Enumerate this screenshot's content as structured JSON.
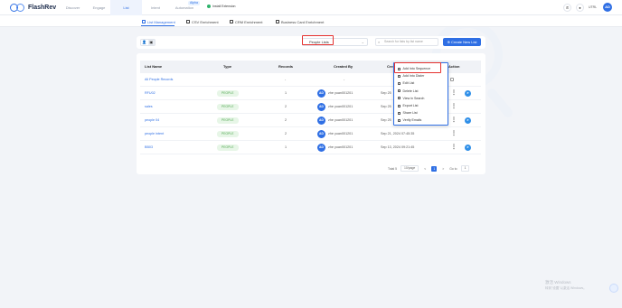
{
  "app": {
    "name": "FlashRev",
    "install_extension": "Install Extension",
    "language": "UTRL",
    "user_initials": "AD"
  },
  "nav": {
    "items": [
      "Discover",
      "Engage",
      "List",
      "Intent",
      "Automation"
    ],
    "alpha_badge": "Alpha"
  },
  "subnav": {
    "tabs": [
      "List Management",
      "CSV Enrichment",
      "CRM Enrichment",
      "Business Card Enrichment"
    ]
  },
  "filter": {
    "select_value": "People Lists",
    "search_placeholder": "Search for lists by list name",
    "create_button": "Create New List"
  },
  "table": {
    "headers": [
      "List Name",
      "Type",
      "Records",
      "Created By",
      "Cre",
      "Action"
    ],
    "rows": [
      {
        "name": "All People Records",
        "type": "",
        "records": "-",
        "creator": "",
        "date": ""
      },
      {
        "name": "RFU02",
        "type": "PEOPLE",
        "records": "1",
        "creator": "zhe yuan001201",
        "date": "Sep 25"
      },
      {
        "name": "sales",
        "type": "PEOPLE",
        "records": "2",
        "creator": "zhe yuan001201",
        "date": "Sep 25"
      },
      {
        "name": "people 04",
        "type": "PEOPLE",
        "records": "2",
        "creator": "zhe yuan001201",
        "date": "Sep 25"
      },
      {
        "name": "people intent",
        "type": "PEOPLE",
        "records": "2",
        "creator": "zhe yuan001201",
        "date": "Sep 21, 2024 07:45:35"
      },
      {
        "name": "BB03",
        "type": "PEOPLE",
        "records": "1",
        "creator": "zhe yuan001201",
        "date": "Sep 13, 2024 09:21:45"
      }
    ]
  },
  "pagination": {
    "total": "Total 5",
    "per_page": "10/page",
    "prev": "<",
    "current": "1",
    "next": ">",
    "goto_label": "Go to",
    "goto_value": "1"
  },
  "menu": {
    "items": [
      "Add Into Sequence",
      "Add Into Dialer",
      "Edit List",
      "Delete List",
      "View in Search",
      "Export List",
      "Share List",
      "Verify Emails"
    ]
  },
  "watermark": {
    "line1": "激活 Windows",
    "line2": "转到\"设置\"以激活 Windows。"
  },
  "colors": {
    "accent": "#2f6fe4",
    "highlight": "#e5312f",
    "tag_bg": "#e7f6e7",
    "tag_text": "#52a852"
  }
}
